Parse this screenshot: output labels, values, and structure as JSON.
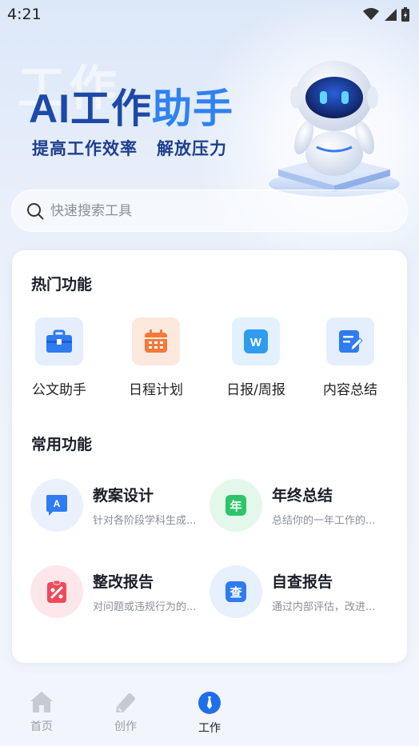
{
  "status_bar": {
    "time": "4:21"
  },
  "hero": {
    "watermark": "工作",
    "title_part1": "AI工作",
    "title_part2": "助手",
    "subtitle_left": "提高工作效率",
    "subtitle_right": "解放压力"
  },
  "search": {
    "placeholder": "快速搜索工具",
    "value": ""
  },
  "hot_section": {
    "title": "热门功能",
    "items": [
      {
        "label": "公文助手",
        "icon": "briefcase-icon",
        "color": "#2f7bf0"
      },
      {
        "label": "日程计划",
        "icon": "calendar-icon",
        "color": "#f37a3a"
      },
      {
        "label": "日报/周报",
        "icon": "word-doc-icon",
        "color": "#2f9cf0"
      },
      {
        "label": "内容总结",
        "icon": "edit-note-icon",
        "color": "#2f7bf0"
      }
    ]
  },
  "common_section": {
    "title": "常用功能",
    "items": [
      {
        "title": "教案设计",
        "desc": "针对各阶段学科生成...",
        "icon": "lesson-plan-icon",
        "glyph": "A",
        "color": "#2f7bf0"
      },
      {
        "title": "年终总结",
        "desc": "总结你的一年工作的...",
        "icon": "year-end-icon",
        "glyph": "年",
        "color": "#2dc46a"
      },
      {
        "title": "整改报告",
        "desc": "对问题或违规行为的...",
        "icon": "rectification-icon",
        "glyph": "",
        "color": "#f04a5a"
      },
      {
        "title": "自查报告",
        "desc": "通过内部评估，改进...",
        "icon": "self-check-icon",
        "glyph": "查",
        "color": "#2f7bf0"
      }
    ]
  },
  "tab_bar": {
    "tabs": [
      {
        "label": "首页",
        "icon": "home-icon",
        "active": false
      },
      {
        "label": "创作",
        "icon": "pencil-icon",
        "active": false
      },
      {
        "label": "工作",
        "icon": "tie-icon",
        "active": true
      }
    ]
  },
  "colors": {
    "accent": "#2f7bf0",
    "title_dark": "#1d49a8",
    "active_tab": "#1f6fe8"
  }
}
